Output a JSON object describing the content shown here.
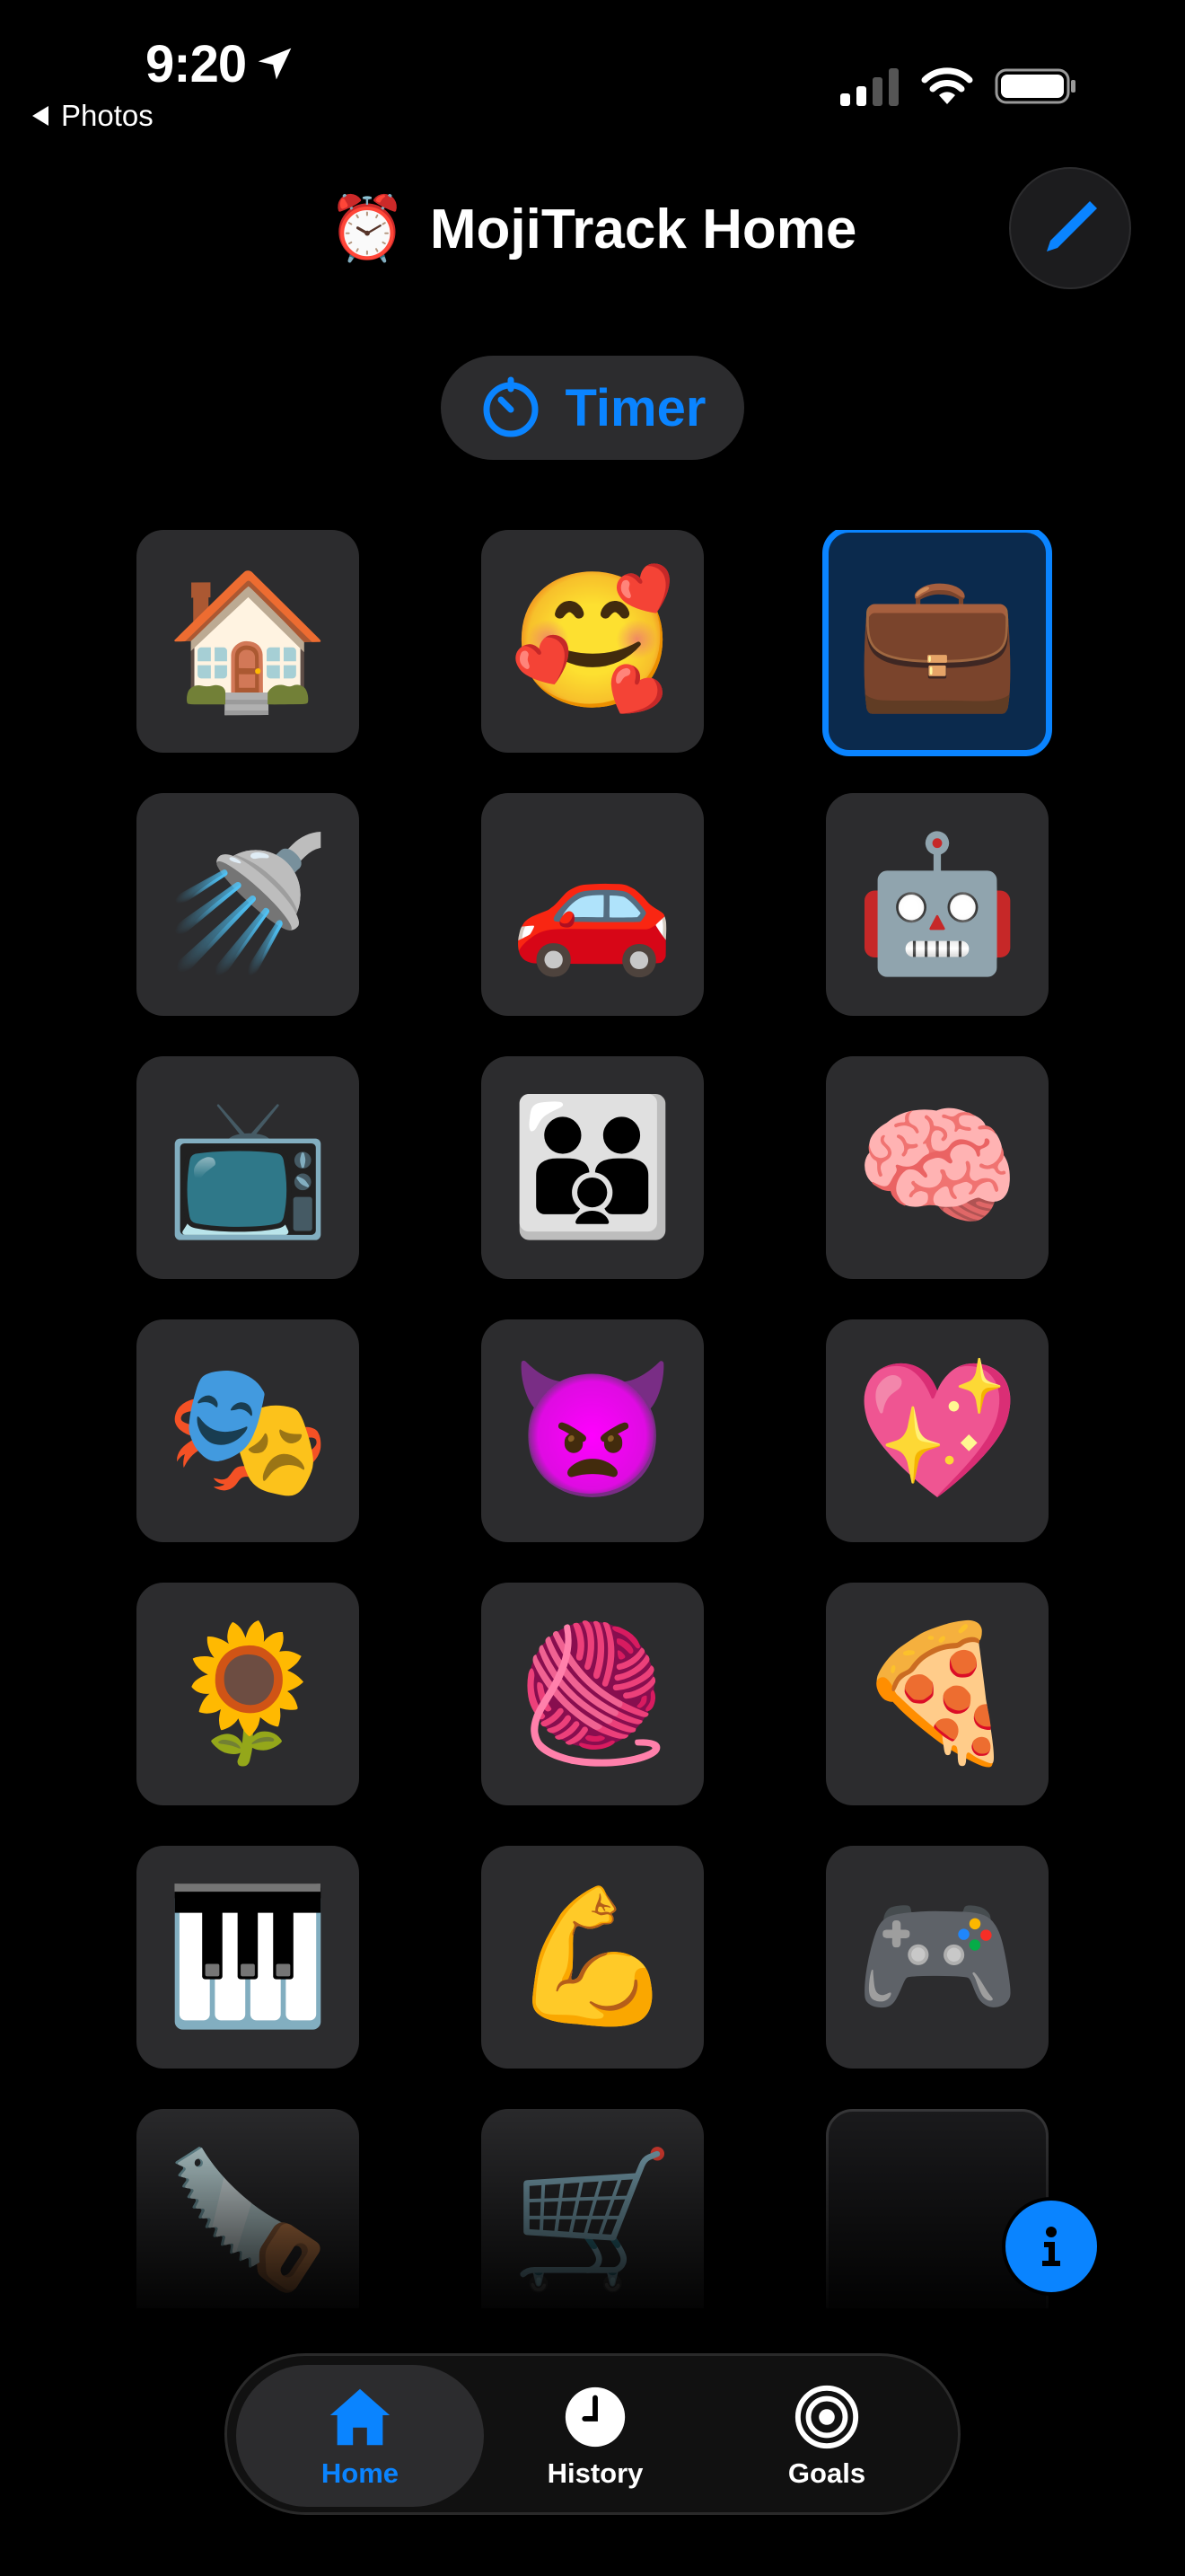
{
  "status_bar": {
    "time": "9:20",
    "back_label": "Photos"
  },
  "header": {
    "clock_emoji": "⏰",
    "title": "MojiTrack Home"
  },
  "timer_button": {
    "label": "Timer"
  },
  "activities": [
    {
      "emoji": "🏠",
      "name": "house"
    },
    {
      "emoji": "🥰",
      "name": "smiling-face-hearts"
    },
    {
      "emoji": "💼",
      "name": "briefcase",
      "selected": true
    },
    {
      "emoji": "🚿",
      "name": "shower"
    },
    {
      "emoji": "🚗",
      "name": "car"
    },
    {
      "emoji": "🤖",
      "name": "robot"
    },
    {
      "emoji": "📺",
      "name": "television"
    },
    {
      "emoji": "👪",
      "name": "family"
    },
    {
      "emoji": "🧠",
      "name": "brain"
    },
    {
      "emoji": "🎭",
      "name": "performing-arts"
    },
    {
      "emoji": "👿",
      "name": "angry-devil"
    },
    {
      "emoji": "💖",
      "name": "sparkling-heart"
    },
    {
      "emoji": "🌻",
      "name": "sunflower"
    },
    {
      "emoji": "🧶",
      "name": "yarn"
    },
    {
      "emoji": "🍕",
      "name": "pizza"
    },
    {
      "emoji": "🎹",
      "name": "piano"
    },
    {
      "emoji": "💪",
      "name": "flexed-biceps"
    },
    {
      "emoji": "🎮",
      "name": "game-controller"
    },
    {
      "emoji": "🪚",
      "name": "saw"
    },
    {
      "emoji": "🛒",
      "name": "shopping-cart"
    },
    {
      "emoji": "",
      "name": "empty-slot"
    }
  ],
  "tab_bar": {
    "tabs": [
      {
        "label": "Home",
        "icon": "house-icon",
        "active": true
      },
      {
        "label": "History",
        "icon": "clock-icon",
        "active": false
      },
      {
        "label": "Goals",
        "icon": "target-icon",
        "active": false
      }
    ]
  },
  "colors": {
    "accent": "#0a84ff",
    "background": "#000000",
    "tile": "#2c2c2e"
  }
}
